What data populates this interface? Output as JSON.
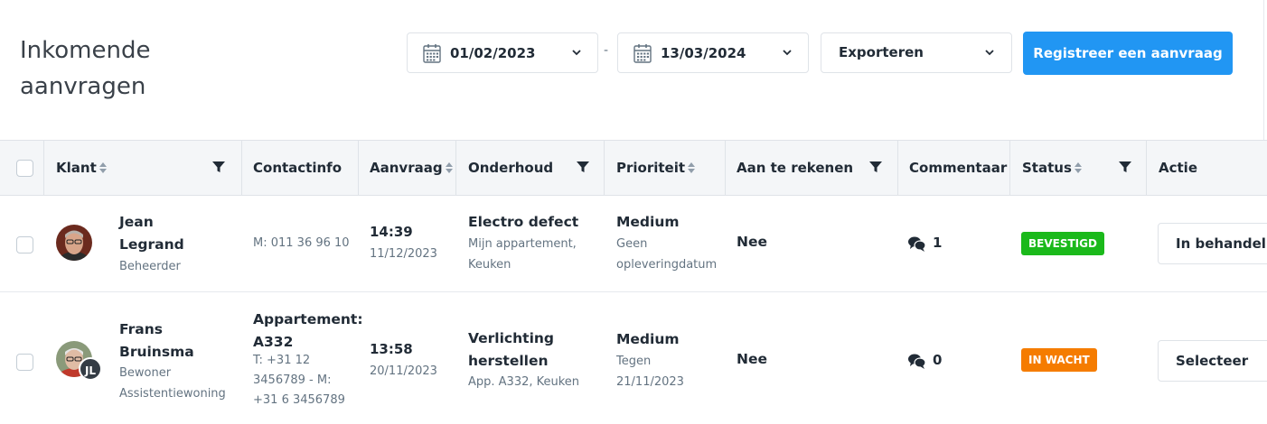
{
  "page": {
    "title": "Inkomende aanvragen"
  },
  "filters": {
    "date_from": "01/02/2023",
    "date_to": "13/03/2024",
    "separator": "-",
    "export_label": "Exporteren",
    "register_label": "Registreer een aanvraag"
  },
  "columns": {
    "klant": "Klant",
    "contactinfo": "Contactinfo",
    "aanvraag": "Aanvraag",
    "onderhoud": "Onderhoud",
    "prioriteit": "Prioriteit",
    "aan_te_rekenen": "Aan te rekenen",
    "commentaar": "Commentaar",
    "status": "Status",
    "actie": "Actie"
  },
  "rows": [
    {
      "first_name": "Jean",
      "last_name": "Legrand",
      "role": "Beheerder",
      "contact_title": "",
      "contact": "M: 011 36 96 10",
      "time": "14:39",
      "date": "11/12/2023",
      "maintenance_title": "Electro defect",
      "maintenance_sub": "Mijn appartement, Keuken",
      "priority": "Medium",
      "priority_sub": "Geen opleveringdatum",
      "billable": "Nee",
      "comments": "1",
      "status": "BEVESTIGD",
      "status_color": "#1bb91b",
      "action": "In behandeling"
    },
    {
      "first_name": "Frans",
      "last_name": "Bruinsma",
      "role": "Bewoner Assistentiewoning",
      "initials": "JL",
      "contact_title": "Appartement: A332",
      "contact": "T: +31 12 3456789 - M: +31 6 3456789",
      "time": "13:58",
      "date": "20/11/2023",
      "maintenance_title": "Verlichting herstellen",
      "maintenance_sub": "App. A332, Keuken",
      "priority": "Medium",
      "priority_sub": "Tegen 21/11/2023",
      "billable": "Nee",
      "comments": "0",
      "status": "IN WACHT",
      "status_color": "#f57c00",
      "action": "Selecteer"
    }
  ]
}
